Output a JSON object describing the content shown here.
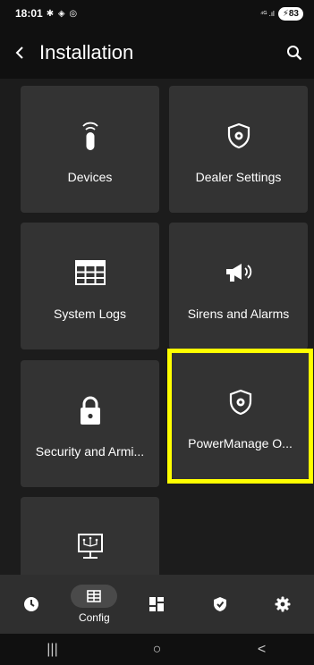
{
  "status_bar": {
    "time": "18:01",
    "left_icons": "✱ ◈ ◎",
    "signal_text": "⁴ᴳ .ıl",
    "battery": "83"
  },
  "app_bar": {
    "title": "Installation"
  },
  "tiles": [
    {
      "label": "Devices",
      "icon": "remote-icon"
    },
    {
      "label": "Dealer Settings",
      "icon": "shield-gear-icon"
    },
    {
      "label": "System Logs",
      "icon": "table-icon"
    },
    {
      "label": "Sirens and Alarms",
      "icon": "megaphone-icon"
    },
    {
      "label": "Security and Armi...",
      "icon": "lock-icon"
    },
    {
      "label": "PowerManage O...",
      "icon": "shield-gear-icon"
    },
    {
      "label": "",
      "icon": "monitor-network-icon"
    }
  ],
  "bottom_nav": [
    {
      "icon": "clock-icon",
      "label": ""
    },
    {
      "icon": "config-icon",
      "label": "Config",
      "active": true
    },
    {
      "icon": "dashboard-icon",
      "label": ""
    },
    {
      "icon": "shield-check-icon",
      "label": ""
    },
    {
      "icon": "gear-icon",
      "label": ""
    }
  ],
  "system_nav": {
    "recents": "|||",
    "home": "○",
    "back": "<"
  },
  "colors": {
    "background": "#1c1c1c",
    "tile": "#333333",
    "highlight": "#ffff00",
    "nav_bar": "#2f2f2f"
  }
}
